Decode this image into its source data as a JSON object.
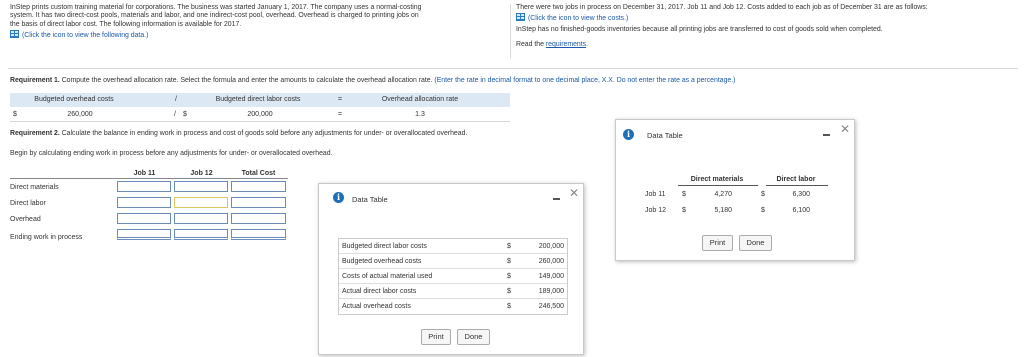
{
  "intro": {
    "line1": "InStep prints custom training material for corporations. The business was started January 1, 2017. The company uses a normal-costing",
    "line2": "system. It has two direct-cost pools, materials and labor, and one indirect-cost pool, overhead. Overhead is charged to printing jobs on",
    "line3": "the basis of direct labor cost. The following information is available for 2017.",
    "link": "(Click the icon to view the following data.)"
  },
  "intro_right": {
    "line1": "There were two jobs in process on December 31, 2017. Job 11 and Job 12. Costs added to each job as of December 31 are as follows:",
    "link": "(Click the icon to view the costs.)",
    "line2": "InStep has no finished-goods inventories because all printing jobs are transferred to cost of goods sold when completed.",
    "read_prefix": "Read the ",
    "read_link": "requirements",
    "read_suffix": "."
  },
  "req1": {
    "bold": "Requirement 1.",
    "text": " Compute the overhead allocation rate. Select the formula and enter the amounts to calculate the overhead allocation rate. ",
    "hint": "(Enter the rate in decimal format to one decimal place, X.X. Do not enter the rate as a percentage.)",
    "h1": "Budgeted overhead costs",
    "op1": "/",
    "h2": "Budgeted direct labor costs",
    "op2": "=",
    "h3": "Overhead allocation rate",
    "dollar1": "$",
    "v1": "260,000",
    "op3": "/",
    "dollar2": "$",
    "v2": "200,000",
    "op4": "=",
    "v3": "1.3"
  },
  "req2": {
    "bold": "Requirement 2.",
    "text": " Calculate the balance in ending work in process and cost of goods sold before any adjustments for under- or overallocated overhead.",
    "sub": "Begin by calculating ending work in process before any adjustments for under- or overallocated overhead.",
    "col1": "Job 11",
    "col2": "Job 12",
    "col3": "Total Cost",
    "rows": [
      "Direct materials",
      "Direct labor",
      "Overhead",
      "Ending work in process"
    ]
  },
  "dialog1": {
    "title": "Data Table",
    "rows": [
      {
        "label": "Budgeted direct labor costs",
        "dollar": "$",
        "value": "200,000"
      },
      {
        "label": "Budgeted overhead costs",
        "dollar": "$",
        "value": "260,000"
      },
      {
        "label": "Costs of actual material used",
        "dollar": "$",
        "value": "149,000"
      },
      {
        "label": "Actual direct labor costs",
        "dollar": "$",
        "value": "189,000"
      },
      {
        "label": "Actual overhead costs",
        "dollar": "$",
        "value": "246,500"
      }
    ],
    "print": "Print",
    "done": "Done"
  },
  "dialog2": {
    "title": "Data Table",
    "h1": "Direct materials",
    "h2": "Direct labor",
    "rows": [
      {
        "job": "Job 11",
        "d1": "$",
        "m": "4,270",
        "d2": "$",
        "l": "6,300"
      },
      {
        "job": "Job 12",
        "d1": "$",
        "m": "5,180",
        "d2": "$",
        "l": "6,100"
      }
    ],
    "print": "Print",
    "done": "Done"
  },
  "colors": {
    "accent": "#1f6fb8",
    "table_header": "#dce8f4",
    "input_border": "#6b8cb8"
  }
}
